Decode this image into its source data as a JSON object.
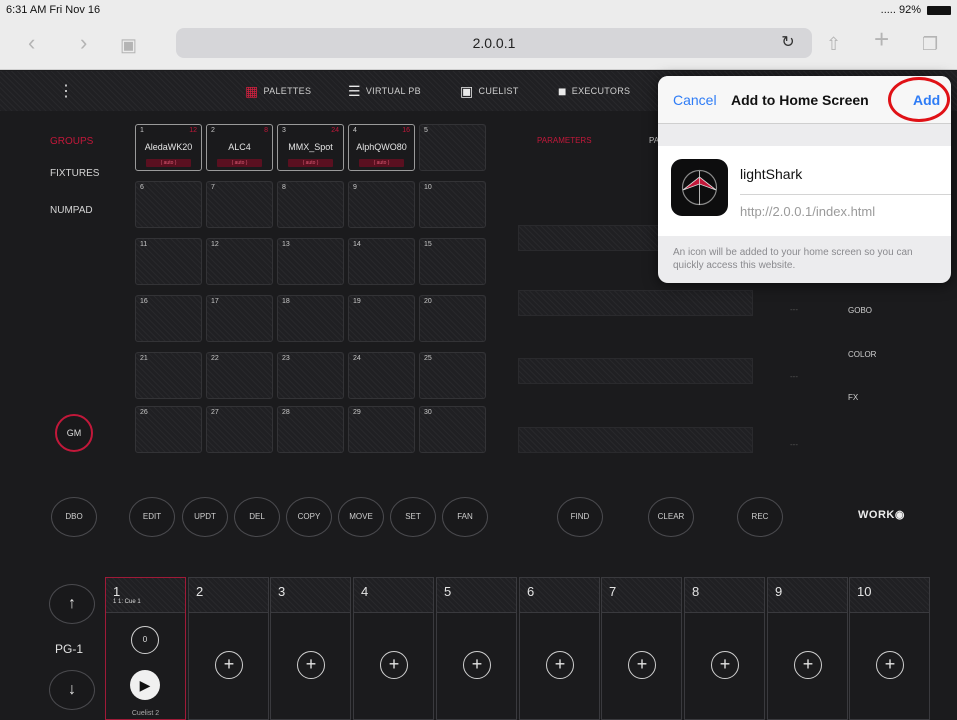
{
  "status_bar": {
    "time": "6:31 AM  Fri Nov 16",
    "battery": "..... 92%"
  },
  "browser": {
    "url": "2.0.0.1"
  },
  "app_tabs": [
    {
      "label": "PALETTES",
      "icon": "palette-grid-icon"
    },
    {
      "label": "VIRTUAL PB",
      "icon": "fader-icon"
    },
    {
      "label": "CUELIST",
      "icon": "cuelist-icon"
    },
    {
      "label": "EXECUTORS",
      "icon": "executors-icon"
    }
  ],
  "left_menu": [
    {
      "label": "GROUPS",
      "active": true
    },
    {
      "label": "FIXTURES",
      "active": false
    },
    {
      "label": "NUMPAD",
      "active": false
    }
  ],
  "groups": [
    {
      "n": "1",
      "r": "12",
      "name": "AledaWK20",
      "auto": "( auto )"
    },
    {
      "n": "2",
      "r": "8",
      "name": "ALC4",
      "auto": "( auto )"
    },
    {
      "n": "3",
      "r": "24",
      "name": "MMX_Spot",
      "auto": "( auto )"
    },
    {
      "n": "4",
      "r": "16",
      "name": "AlphQWO80",
      "auto": "( auto )"
    },
    {
      "n": "5"
    },
    {
      "n": "6"
    },
    {
      "n": "7"
    },
    {
      "n": "8"
    },
    {
      "n": "9"
    },
    {
      "n": "10"
    },
    {
      "n": "11"
    },
    {
      "n": "12"
    },
    {
      "n": "13"
    },
    {
      "n": "14"
    },
    {
      "n": "15"
    },
    {
      "n": "16"
    },
    {
      "n": "17"
    },
    {
      "n": "18"
    },
    {
      "n": "19"
    },
    {
      "n": "20"
    },
    {
      "n": "21"
    },
    {
      "n": "22"
    },
    {
      "n": "23"
    },
    {
      "n": "24"
    },
    {
      "n": "25"
    },
    {
      "n": "26"
    },
    {
      "n": "27"
    },
    {
      "n": "28"
    },
    {
      "n": "29"
    },
    {
      "n": "30"
    }
  ],
  "right_panel": {
    "parameters_label": "PARAMETERS",
    "pa_label": "PA",
    "dash": "---",
    "labels": [
      "GOBO",
      "COLOR",
      "FX"
    ]
  },
  "gm_label": "GM",
  "buttons": [
    "DBO",
    "EDIT",
    "UPDT",
    "DEL",
    "COPY",
    "MOVE",
    "SET",
    "FAN",
    "FIND",
    "CLEAR",
    "REC"
  ],
  "logo": "WORK",
  "page_nav": {
    "up": "↑",
    "label": "PG-1",
    "down": "↓"
  },
  "executors": [
    {
      "num": "1",
      "cue": "1  1: Cue 1",
      "knob": "0",
      "cuelist": "Cuelist 2"
    },
    {
      "num": "2"
    },
    {
      "num": "3"
    },
    {
      "num": "4"
    },
    {
      "num": "5"
    },
    {
      "num": "6"
    },
    {
      "num": "7"
    },
    {
      "num": "8"
    },
    {
      "num": "9"
    },
    {
      "num": "10"
    }
  ],
  "popup": {
    "cancel": "Cancel",
    "title": "Add to Home Screen",
    "add": "Add",
    "app_name": "lightShark",
    "app_url": "http://2.0.0.1/index.html",
    "note": "An icon will be added to your home screen so you can quickly access this website."
  }
}
